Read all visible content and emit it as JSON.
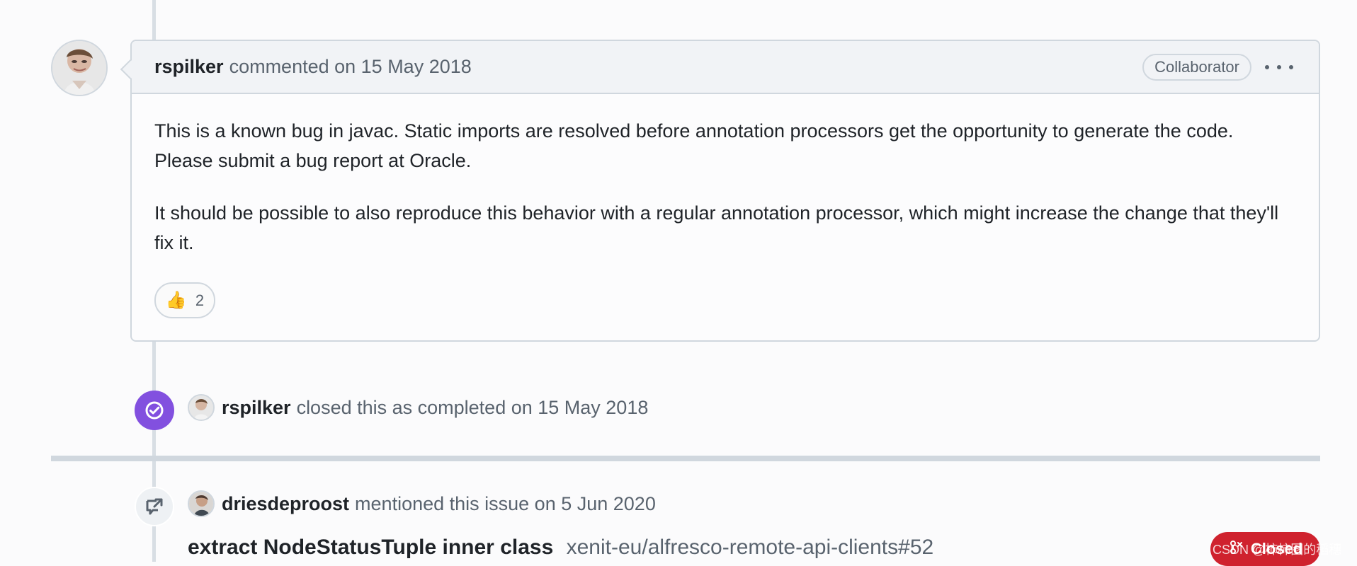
{
  "comment": {
    "author": "rspilker",
    "meta": "commented on 15 May 2018",
    "badge": "Collaborator",
    "body": [
      "This is a known bug in javac. Static imports are resolved before annotation processors get the opportunity to generate the code. Please submit a bug report at Oracle.",
      "It should be possible to also reproduce this behavior with a regular annotation processor, which might increase the change that they'll fix it."
    ],
    "reaction": {
      "emoji": "👍",
      "count": "2"
    }
  },
  "events": [
    {
      "actor": "rspilker",
      "text": "closed this as completed on 15 May 2018"
    },
    {
      "actor": "driesdeproost",
      "text": "mentioned this issue on 5 Jun 2020"
    }
  ],
  "reference": {
    "title": "extract NodeStatusTuple inner class",
    "repo": "xenit-eu/alfresco-remote-api-clients#52",
    "status": "Closed"
  },
  "watermark": "CSDN @柿柿图的稻穗",
  "icons": {
    "kebab": "kebab-horizontal-icon",
    "closed": "check-circle-icon",
    "mention": "cross-reference-icon",
    "issue_closed": "issue-closed-icon"
  },
  "colors": {
    "accent_closed": "#8250df",
    "badge_closed": "#cf222e",
    "border": "#d0d7de"
  }
}
